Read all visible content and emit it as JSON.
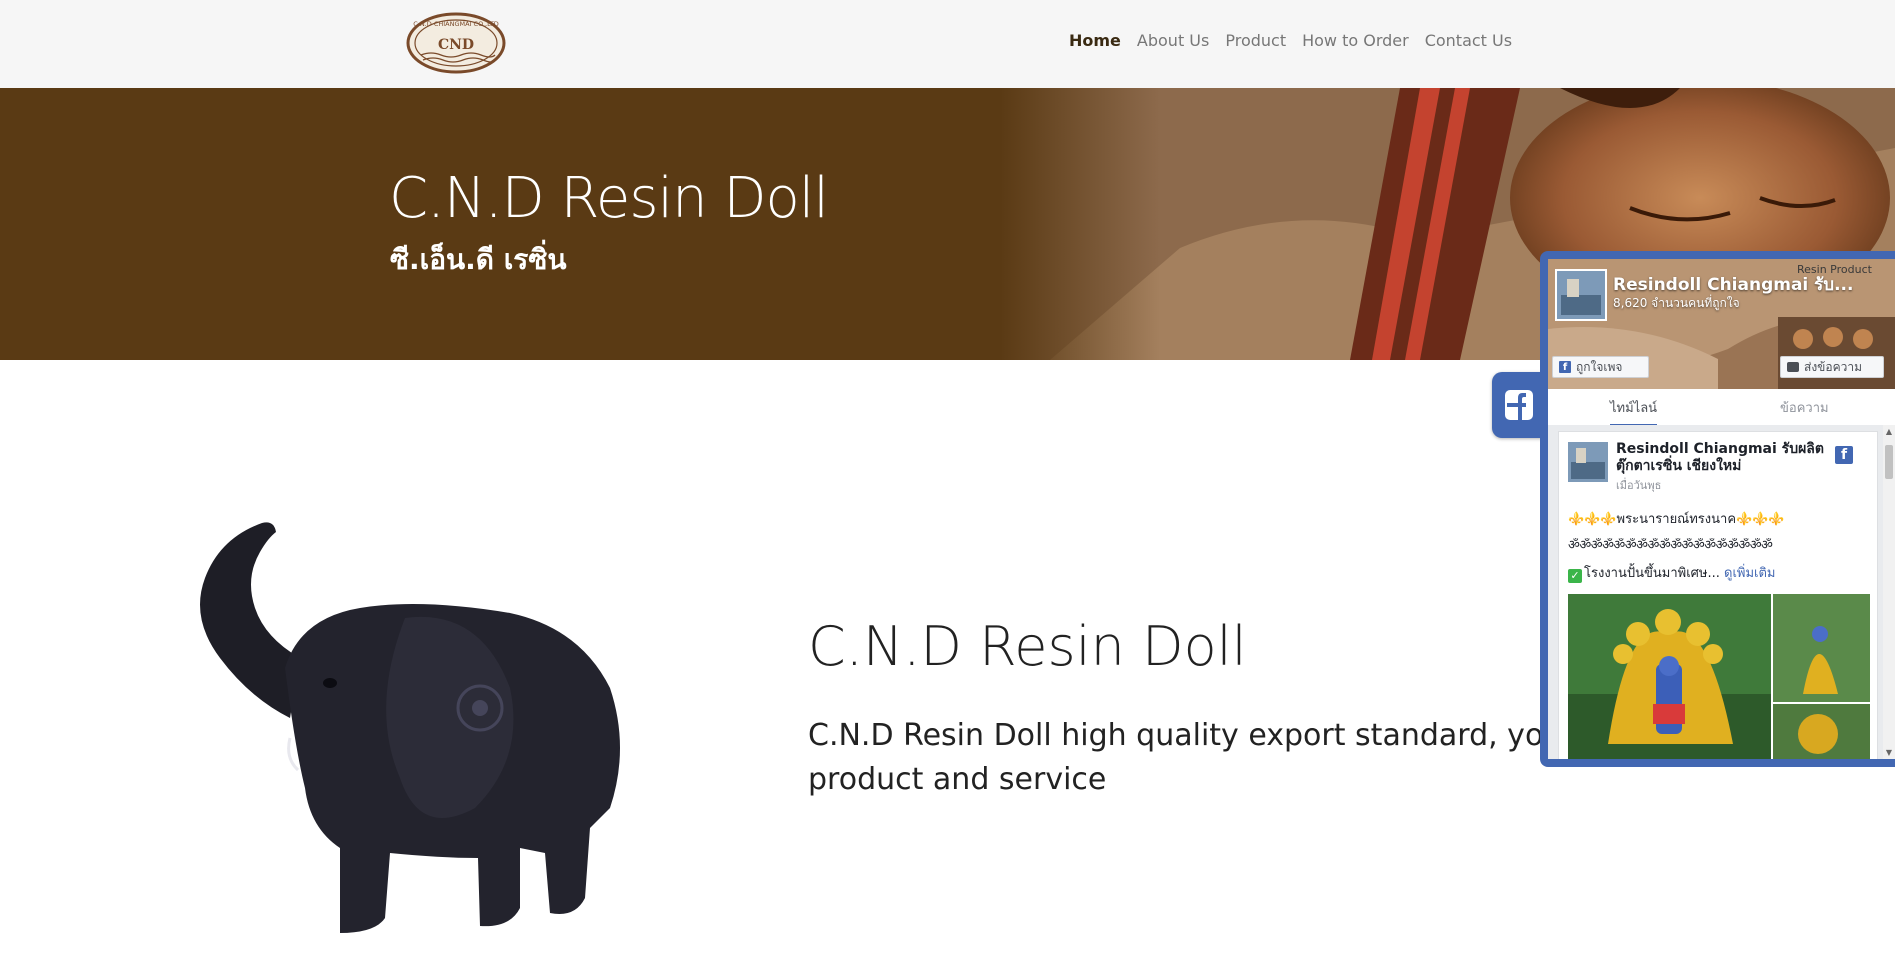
{
  "nav": {
    "logo_text": "C.N.D CHIANGMAI CO.,LTD",
    "logo_mark": "CND",
    "items": [
      {
        "label": "Home",
        "active": true
      },
      {
        "label": "About Us",
        "active": false
      },
      {
        "label": "Product",
        "active": false
      },
      {
        "label": "How to Order",
        "active": false
      },
      {
        "label": "Contact Us",
        "active": false
      }
    ]
  },
  "hero": {
    "title": "C.N.D Resin Doll",
    "subtitle": "ซี.เอ็น.ดี เรซิ่น"
  },
  "main": {
    "heading": "C.N.D Resin Doll",
    "text": "C.N.D Resin Doll high quality export standard, you can trust our product and service"
  },
  "facebook": {
    "tab_icon": "facebook-f-icon",
    "page_name": "Resindoll Chiangmai รับ...",
    "likes": "8,620 จำนวนคนที่ถูกใจ",
    "corner_label": "Resin Product",
    "like_button": "ถูกใจเพจ",
    "message_button": "ส่งข้อความ",
    "tabs": {
      "timeline": "ไทม์ไลน์",
      "messages": "ข้อความ"
    },
    "post": {
      "author": "Resindoll Chiangmai รับผลิตตุ๊กตาเรซิ่น เชียงใหม่",
      "time": "เมื่อวันพุธ",
      "line1": "⚜️⚜️⚜️พระนารายณ์ทรงนาค⚜️⚜️⚜️",
      "line2": "ॐॐॐॐॐॐॐॐॐॐॐॐॐॐॐॐॐॐ",
      "line3": "โรงงานปั้นขึ้นมาพิเศษ...",
      "see_more": "ดูเพิ่มเติม"
    },
    "brand_color": "#4267b2"
  }
}
